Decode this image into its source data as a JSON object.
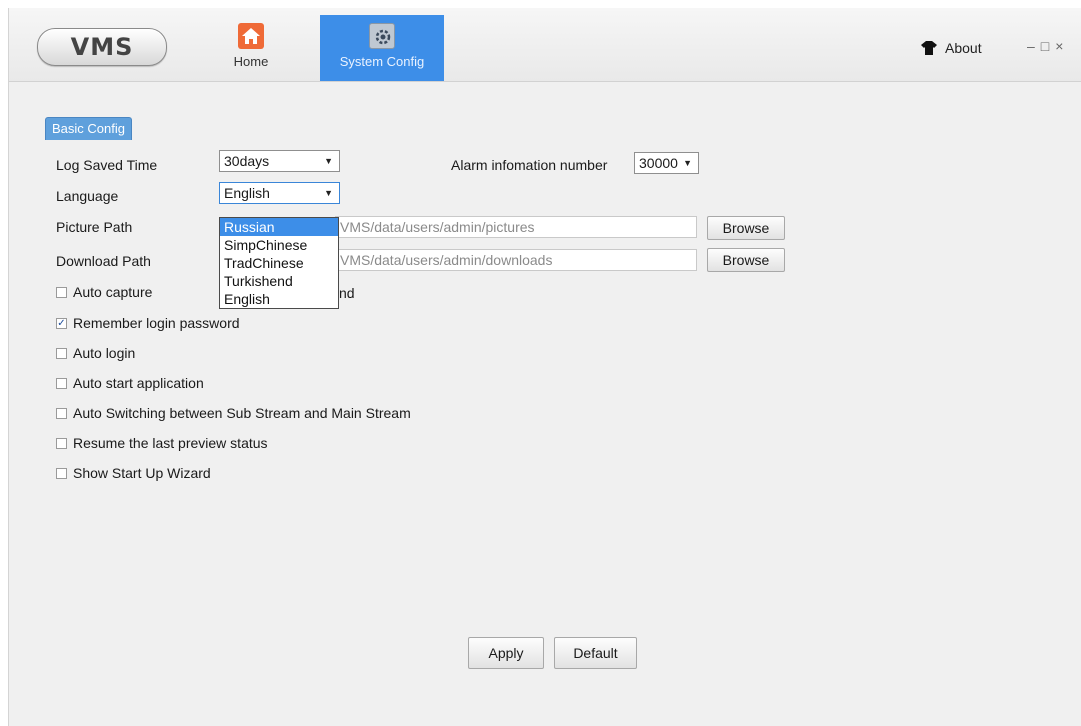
{
  "app": {
    "logo_text": "VMS"
  },
  "nav": {
    "home_label": "Home",
    "system_config_label": "System Config"
  },
  "header": {
    "about_label": "About",
    "window_controls": "–□×"
  },
  "tab": {
    "basic_config": "Basic Config"
  },
  "form": {
    "log_saved_time_label": "Log Saved Time",
    "log_saved_time_value": "30days",
    "alarm_info_label": "Alarm infomation number",
    "alarm_info_value": "30000",
    "language_label": "Language",
    "language_value": "English",
    "picture_path_label": "Picture Path",
    "picture_path_value": "VMS/data/users/admin/pictures",
    "download_path_label": "Download Path",
    "download_path_value": "VMS/data/users/admin/downloads",
    "browse_label": "Browse",
    "auto_capture_label": "Auto capture",
    "auto_capture_trailing": "nd"
  },
  "language_options": [
    "Russian",
    "SimpChinese",
    "TradChinese",
    "Turkishend",
    "English"
  ],
  "checkboxes": [
    {
      "label": "Remember login password",
      "checked": true,
      "mark": "✓"
    },
    {
      "label": "Auto login",
      "checked": false,
      "mark": ""
    },
    {
      "label": "Auto start application",
      "checked": false,
      "mark": ""
    },
    {
      "label": "Auto Switching between Sub Stream and Main Stream",
      "checked": false,
      "mark": ""
    },
    {
      "label": "Resume the last preview status",
      "checked": false,
      "mark": ""
    },
    {
      "label": "Show Start Up Wizard",
      "checked": false,
      "mark": ""
    }
  ],
  "buttons": {
    "apply": "Apply",
    "default": "Default"
  },
  "colors": {
    "accent": "#3d8ee8",
    "tab": "#5fa0dc",
    "home_icon": "#ef6a37"
  }
}
